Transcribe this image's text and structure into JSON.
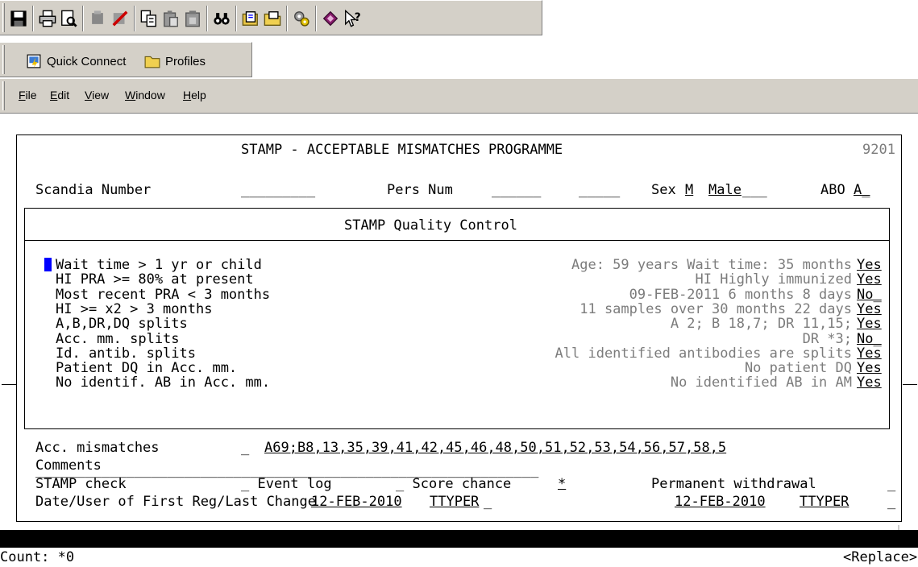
{
  "toolbar": {
    "icons": [
      "save-icon",
      "print-icon",
      "print-preview-icon",
      "disabled-icon-1",
      "disabled-icon-2",
      "copy-icon",
      "paste-icon",
      "paste-special-icon",
      "find-icon",
      "open-session-icon",
      "open-folder-icon",
      "settings-icon",
      "help-book-icon",
      "context-help-icon"
    ]
  },
  "quick_connect": {
    "label": "Quick Connect",
    "profiles_label": "Profiles"
  },
  "menu": {
    "file": "File",
    "edit": "Edit",
    "view": "View",
    "window": "Window",
    "help": "Help",
    "file_key": "F",
    "edit_key": "E",
    "view_key": "V",
    "window_key": "W",
    "help_key": "H"
  },
  "screen": {
    "title": "STAMP - ACCEPTABLE MISMATCHES PROGRAMME",
    "code": "9201",
    "scandia_label": "Scandia Number",
    "scandia_value": "_________",
    "persnum_label": "Pers Num",
    "persnum_value1": "______",
    "persnum_value2": "_____",
    "sex_label": "Sex",
    "sex_code": "M",
    "sex_text": "Male",
    "sex_pad": "___",
    "abo_label": "ABO",
    "abo_value": "A_",
    "qc_title": "STAMP Quality Control"
  },
  "qc_rows": [
    {
      "label": "Wait time > 1 yr or child",
      "detail": "Age: 59 years Wait time: 35 months",
      "value": "Yes"
    },
    {
      "label": "HI PRA >= 80% at present",
      "detail": "HI Highly immunized",
      "value": "Yes"
    },
    {
      "label": "Most recent PRA < 3 months",
      "detail": "09-FEB-2011 6 months 8 days",
      "value": "No_"
    },
    {
      "label": "HI >= x2 > 3 months",
      "detail": "11 samples over 30 months 22 days",
      "value": "Yes"
    },
    {
      "label": "A,B,DR,DQ splits",
      "detail": "A 2; B 18,7; DR 11,15;",
      "value": "Yes"
    },
    {
      "label": "Acc. mm. splits",
      "detail": "DR *3;",
      "value": "No_"
    },
    {
      "label": "Id. antib. splits",
      "detail": "All identified antibodies are splits",
      "value": "Yes"
    },
    {
      "label": "Patient DQ in Acc. mm.",
      "detail": "No patient DQ",
      "value": "Yes"
    },
    {
      "label": "No identif. AB in Acc. mm.",
      "detail": "No identified AB in AM",
      "value": "Yes"
    }
  ],
  "footer": {
    "acc_label": "Acc. mismatches",
    "acc_flag": "_",
    "acc_value": "A69;B8,13,35,39,41,42,45,46,48,50,51,52,53,54,56,57,58,5",
    "comments_label": "Comments",
    "comments_value": "_____________________________________________________________",
    "stamp_label": "STAMP check",
    "event_log": "_ Event log",
    "score_chance": "_ Score chance",
    "score_value": "*",
    "withdrawal": "Permanent withdrawal",
    "withdrawal_value": "_",
    "date_label": "Date/User of First Reg/Last Change",
    "first_date": "12-FEB-2010",
    "first_user": "TTYPER",
    "first_pad": "_",
    "last_date": "12-FEB-2010",
    "last_user": "TTYPER",
    "last_pad": "_"
  },
  "status": {
    "count": "Count: *0",
    "mode": "<Replace>"
  }
}
